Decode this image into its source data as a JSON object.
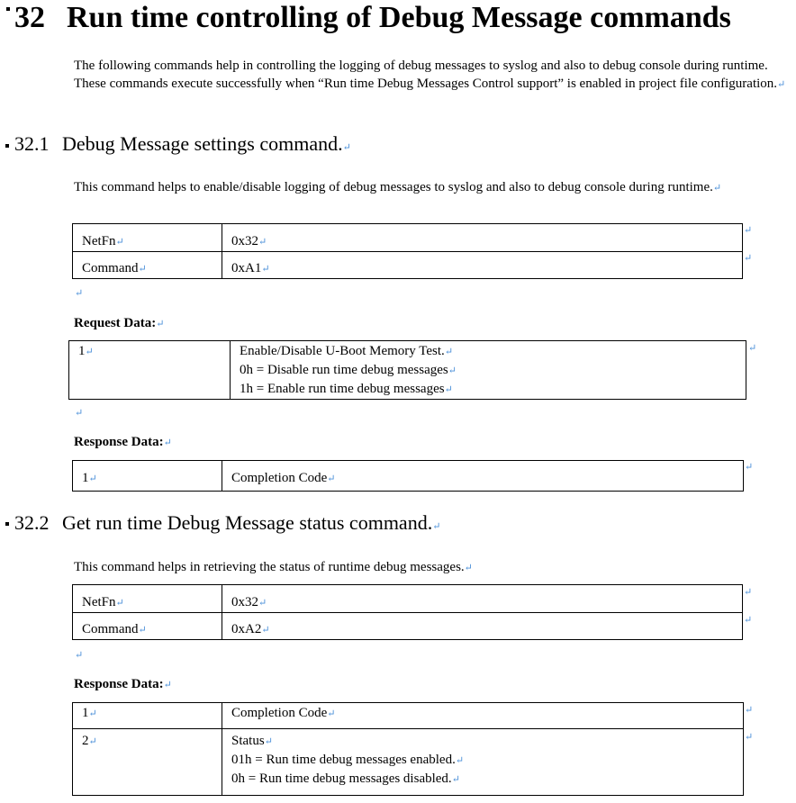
{
  "section": {
    "number": "32",
    "title": "Run time controlling of Debug Message commands",
    "intro": "The following commands help in controlling the logging of debug messages to syslog and also to debug console during runtime. These commands execute successfully when “Run time Debug Messages Control support” is enabled in project file configuration.",
    "para_mark": "↵"
  },
  "subsection1": {
    "number": "32.1",
    "title": "Debug Message settings command.",
    "description": "This command helps to enable/disable logging of debug messages to syslog and also to debug console during runtime.",
    "netfn_label": "NetFn",
    "netfn_value": "0x32",
    "command_label": "Command",
    "command_value": "0xA1",
    "request_label": "Request Data:",
    "request_rows": [
      {
        "byte": "1",
        "lines": [
          "Enable/Disable U-Boot Memory Test.",
          "0h = Disable run time debug messages",
          "1h = Enable run time debug messages"
        ]
      }
    ],
    "response_label": "Response Data:",
    "response_rows": [
      {
        "byte": "1",
        "text": "Completion Code"
      }
    ]
  },
  "subsection2": {
    "number": "32.2",
    "title": "Get run time Debug Message status command.",
    "description": "This command helps in retrieving the status of runtime debug messages.",
    "netfn_label": "NetFn",
    "netfn_value": "0x32",
    "command_label": "Command",
    "command_value": "0xA2",
    "response_label": "Response Data:",
    "response_rows": [
      {
        "byte": "1",
        "lines": [
          "Completion Code"
        ]
      },
      {
        "byte": "2",
        "lines": [
          "Status",
          "01h = Run time debug messages enabled.",
          "0h = Run time debug messages disabled."
        ]
      }
    ]
  }
}
